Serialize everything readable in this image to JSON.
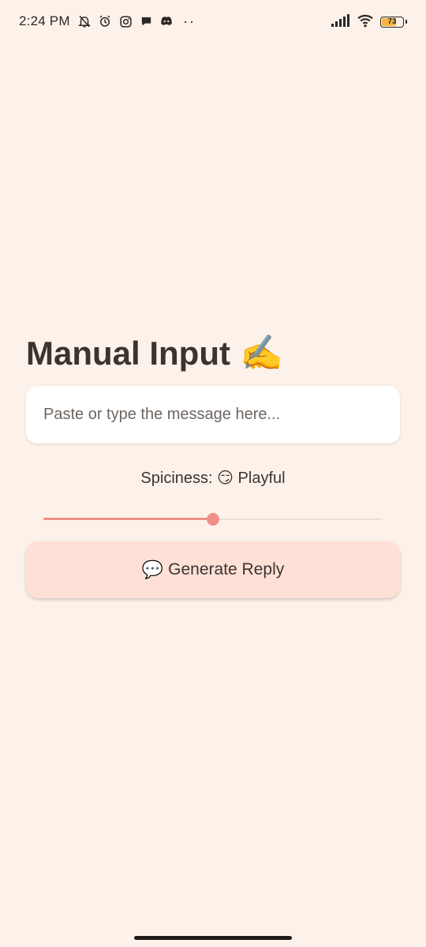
{
  "status_bar": {
    "time": "2:24 PM",
    "left_icons": [
      "bell-off-icon",
      "alarm-icon",
      "instagram-icon",
      "chat-bubble-icon",
      "discord-icon"
    ],
    "more_dots": "··",
    "right_icons": [
      "signal-icon",
      "wifi-icon"
    ],
    "battery_percent": "73",
    "battery_level": 0.73
  },
  "main": {
    "title": "Manual Input",
    "title_emoji": "✍️",
    "message_input": {
      "placeholder": "Paste or type the message here...",
      "value": ""
    },
    "spiciness_label": "Spiciness: 😏 Playful",
    "slider": {
      "value": 0.5
    },
    "generate_button": {
      "emoji": "💬",
      "label": "Generate Reply"
    }
  },
  "colors": {
    "background": "#fdf2ea",
    "accent": "#ef8f86",
    "button_bg": "#ffe0d7",
    "battery": "#f5b73d"
  }
}
